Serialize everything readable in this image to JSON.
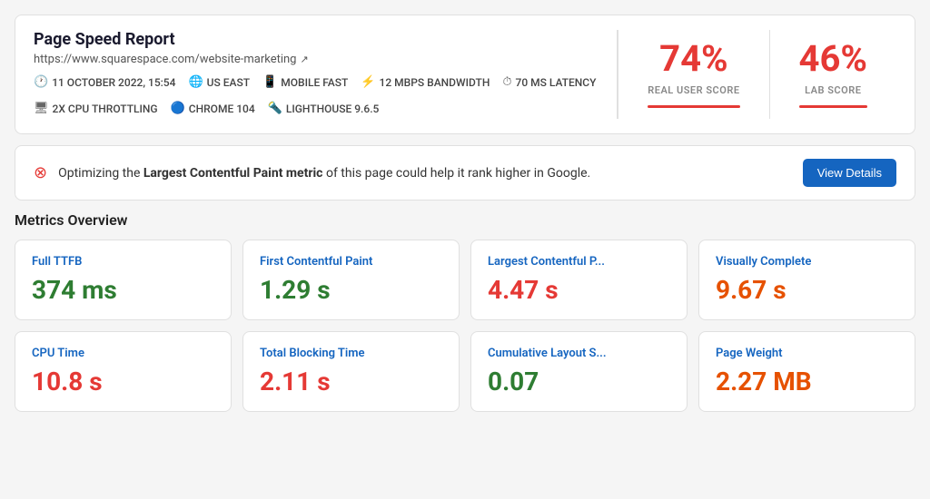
{
  "header": {
    "title": "Page Speed Report",
    "url": "https://www.squarespace.com/website-marketing",
    "ext_link_symbol": "↗",
    "meta": [
      {
        "icon": "🕐",
        "label": "11 OCTOBER 2022, 15:54"
      },
      {
        "icon": "🌐",
        "label": "US EAST"
      },
      {
        "icon": "📱",
        "label": "MOBILE FAST"
      },
      {
        "icon": "⚡",
        "label": "12 MBPS BANDWIDTH"
      },
      {
        "icon": "⏱",
        "label": "70 MS LATENCY"
      },
      {
        "icon": "🖥",
        "label": "2X CPU THROTTLING"
      },
      {
        "icon": "🔵",
        "label": "CHROME 104"
      },
      {
        "icon": "🔦",
        "label": "LIGHTHOUSE 9.6.5"
      }
    ]
  },
  "scores": [
    {
      "id": "real-user-score",
      "value": "74%",
      "label": "REAL USER SCORE",
      "color": "red"
    },
    {
      "id": "lab-score",
      "value": "46%",
      "label": "LAB SCORE",
      "color": "red"
    }
  ],
  "alert": {
    "text_before": "Optimizing the ",
    "text_bold": "Largest Contentful Paint metric",
    "text_after": " of this page could help it rank higher in Google.",
    "button_label": "View Details"
  },
  "metrics_section": {
    "title": "Metrics Overview",
    "metrics": [
      {
        "name": "Full TTFB",
        "value": "374 ms",
        "color": "green"
      },
      {
        "name": "First Contentful Paint",
        "value": "1.29 s",
        "color": "green"
      },
      {
        "name": "Largest Contentful P...",
        "value": "4.47 s",
        "color": "red"
      },
      {
        "name": "Visually Complete",
        "value": "9.67 s",
        "color": "orange"
      },
      {
        "name": "CPU Time",
        "value": "10.8 s",
        "color": "red"
      },
      {
        "name": "Total Blocking Time",
        "value": "2.11 s",
        "color": "red"
      },
      {
        "name": "Cumulative Layout S...",
        "value": "0.07",
        "color": "green"
      },
      {
        "name": "Page Weight",
        "value": "2.27 MB",
        "color": "orange"
      }
    ]
  }
}
